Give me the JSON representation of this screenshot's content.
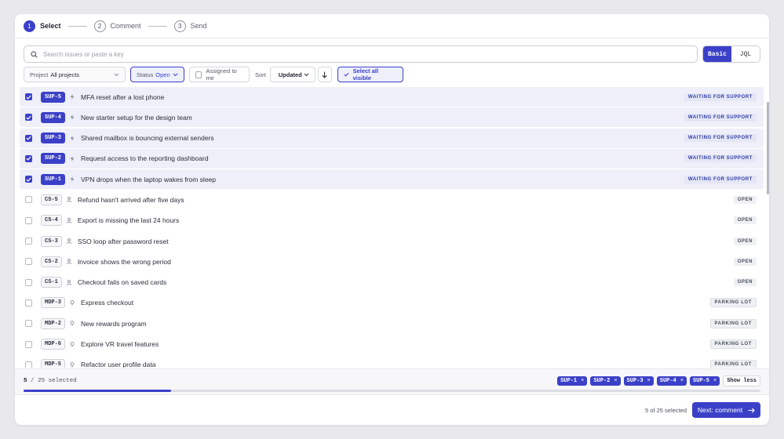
{
  "stepper": {
    "steps": [
      {
        "num": "1",
        "label": "Select"
      },
      {
        "num": "2",
        "label": "Comment"
      },
      {
        "num": "3",
        "label": "Send"
      }
    ]
  },
  "search": {
    "placeholder": "Search issues or paste a key",
    "modes": [
      "Basic",
      "JQL"
    ],
    "active_mode": "Basic"
  },
  "filters": {
    "project_label": "Project",
    "project_value": "All projects",
    "status_label": "Status",
    "status_value": "Open",
    "assigned_label": "Assigned to me",
    "sort_label": "Sort",
    "sort_value": "Updated",
    "select_all_label": "Select all visible"
  },
  "issues": [
    {
      "key": "SUP-5",
      "title": "MFA reset after a lost phone",
      "status": "WAITING FOR SUPPORT",
      "selected": true,
      "icon": "bolt-icon"
    },
    {
      "key": "SUP-4",
      "title": "New starter setup for the design team",
      "status": "WAITING FOR SUPPORT",
      "selected": true,
      "icon": "bolt-icon"
    },
    {
      "key": "SUP-3",
      "title": "Shared mailbox is bouncing external senders",
      "status": "WAITING FOR SUPPORT",
      "selected": true,
      "icon": "bolt-icon"
    },
    {
      "key": "SUP-2",
      "title": "Request access to the reporting dashboard",
      "status": "WAITING FOR SUPPORT",
      "selected": true,
      "icon": "bolt-icon"
    },
    {
      "key": "SUP-1",
      "title": "VPN drops when the laptop wakes from sleep",
      "status": "WAITING FOR SUPPORT",
      "selected": true,
      "icon": "bolt-icon"
    },
    {
      "key": "CS-5",
      "title": "Refund hasn't arrived after five days",
      "status": "OPEN",
      "selected": false,
      "icon": "person-icon"
    },
    {
      "key": "CS-4",
      "title": "Export is missing the last 24 hours",
      "status": "OPEN",
      "selected": false,
      "icon": "person-icon"
    },
    {
      "key": "CS-3",
      "title": "SSO loop after password reset",
      "status": "OPEN",
      "selected": false,
      "icon": "person-icon"
    },
    {
      "key": "CS-2",
      "title": "Invoice shows the wrong period",
      "status": "OPEN",
      "selected": false,
      "icon": "person-icon"
    },
    {
      "key": "CS-1",
      "title": "Checkout fails on saved cards",
      "status": "OPEN",
      "selected": false,
      "icon": "person-icon"
    },
    {
      "key": "MDP-3",
      "title": "Express checkout",
      "status": "PARKING LOT",
      "selected": false,
      "icon": "bulb-icon"
    },
    {
      "key": "MDP-2",
      "title": "New rewards program",
      "status": "PARKING LOT",
      "selected": false,
      "icon": "bulb-icon"
    },
    {
      "key": "MDP-6",
      "title": "Explore VR travel features",
      "status": "PARKING LOT",
      "selected": false,
      "icon": "bulb-icon"
    },
    {
      "key": "MDP-5",
      "title": "Refactor user profile data",
      "status": "PARKING LOT",
      "selected": false,
      "icon": "bulb-icon"
    }
  ],
  "selection": {
    "selected": "5",
    "separator": "/",
    "total": "25",
    "suffix": "selected",
    "progress": 0.2,
    "chips": [
      "SUP-1",
      "SUP-2",
      "SUP-3",
      "SUP-4",
      "SUP-5"
    ],
    "show_less": "Show less"
  },
  "footer": {
    "count_text": "5 of 25 selected",
    "next_label": "Next: comment"
  },
  "colors": {
    "accent": "#3b40c8"
  }
}
